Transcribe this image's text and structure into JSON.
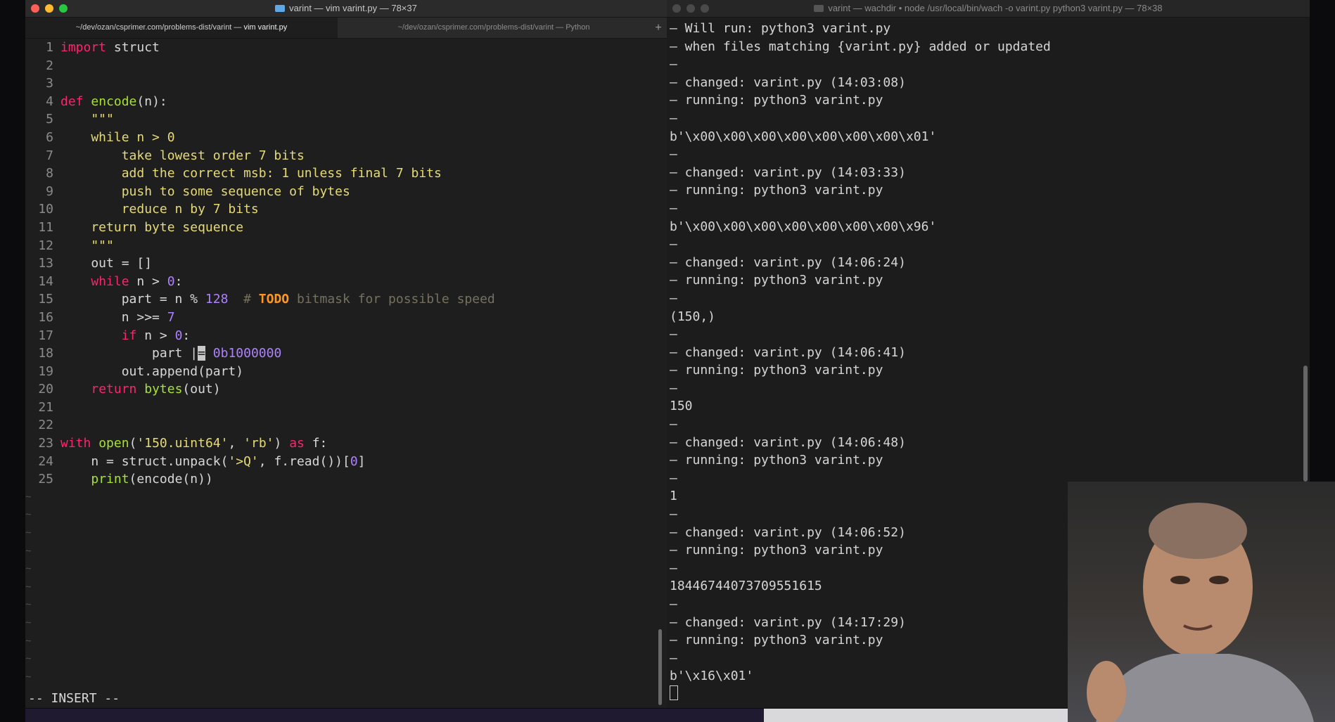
{
  "left_window": {
    "title": "varint — vim varint.py — 78×37",
    "tabs": [
      {
        "path": "~/dev/ozan/csprimer.com/problems-dist/varint — ",
        "cmd": "vim varint.py"
      },
      {
        "path": "~/dev/ozan/csprimer.com/problems-dist/varint — Python",
        "cmd": ""
      }
    ],
    "add_tab_label": "+",
    "code_lines": [
      {
        "n": "1",
        "segs": [
          [
            "kw",
            "import"
          ],
          [
            "p",
            " struct"
          ]
        ]
      },
      {
        "n": "2",
        "segs": []
      },
      {
        "n": "3",
        "segs": []
      },
      {
        "n": "4",
        "segs": [
          [
            "kw",
            "def"
          ],
          [
            "p",
            " "
          ],
          [
            "fn",
            "encode"
          ],
          [
            "p",
            "(n):"
          ]
        ]
      },
      {
        "n": "5",
        "segs": [
          [
            "str",
            "    \"\"\""
          ]
        ]
      },
      {
        "n": "6",
        "segs": [
          [
            "str",
            "    while n > 0"
          ]
        ]
      },
      {
        "n": "7",
        "segs": [
          [
            "str",
            "        take lowest order 7 bits"
          ]
        ]
      },
      {
        "n": "8",
        "segs": [
          [
            "str",
            "        add the correct msb: 1 unless final 7 bits"
          ]
        ]
      },
      {
        "n": "9",
        "segs": [
          [
            "str",
            "        push to some sequence of bytes"
          ]
        ]
      },
      {
        "n": "10",
        "segs": [
          [
            "str",
            "        reduce n by 7 bits"
          ]
        ]
      },
      {
        "n": "11",
        "segs": [
          [
            "str",
            "    return byte sequence"
          ]
        ]
      },
      {
        "n": "12",
        "segs": [
          [
            "str",
            "    \"\"\""
          ]
        ]
      },
      {
        "n": "13",
        "segs": [
          [
            "p",
            "    out = []"
          ]
        ]
      },
      {
        "n": "14",
        "segs": [
          [
            "p",
            "    "
          ],
          [
            "kw",
            "while"
          ],
          [
            "p",
            " n > "
          ],
          [
            "num",
            "0"
          ],
          [
            "p",
            ":"
          ]
        ]
      },
      {
        "n": "15",
        "segs": [
          [
            "p",
            "        part = n % "
          ],
          [
            "num",
            "128"
          ],
          [
            "p",
            "  "
          ],
          [
            "cmt",
            "# "
          ],
          [
            "todo",
            "TODO"
          ],
          [
            "cmt",
            " bitmask for possible speed"
          ]
        ]
      },
      {
        "n": "16",
        "segs": [
          [
            "p",
            "        n >>= "
          ],
          [
            "num",
            "7"
          ]
        ]
      },
      {
        "n": "17",
        "segs": [
          [
            "p",
            "        "
          ],
          [
            "kw",
            "if"
          ],
          [
            "p",
            " n > "
          ],
          [
            "num",
            "0"
          ],
          [
            "p",
            ":"
          ]
        ]
      },
      {
        "n": "18",
        "segs": [
          [
            "p",
            "            part |"
          ],
          [
            "cur",
            "="
          ],
          [
            "p",
            " "
          ],
          [
            "num",
            "0b1000000"
          ]
        ]
      },
      {
        "n": "19",
        "segs": [
          [
            "p",
            "        out.append(part)"
          ]
        ]
      },
      {
        "n": "20",
        "segs": [
          [
            "p",
            "    "
          ],
          [
            "kw",
            "return"
          ],
          [
            "p",
            " "
          ],
          [
            "fn",
            "bytes"
          ],
          [
            "p",
            "(out)"
          ]
        ]
      },
      {
        "n": "21",
        "segs": []
      },
      {
        "n": "22",
        "segs": []
      },
      {
        "n": "23",
        "segs": [
          [
            "kw",
            "with"
          ],
          [
            "p",
            " "
          ],
          [
            "fn",
            "open"
          ],
          [
            "p",
            "("
          ],
          [
            "str",
            "'150.uint64'"
          ],
          [
            "p",
            ", "
          ],
          [
            "str",
            "'rb'"
          ],
          [
            "p",
            ") "
          ],
          [
            "kw",
            "as"
          ],
          [
            "p",
            " f:"
          ]
        ]
      },
      {
        "n": "24",
        "segs": [
          [
            "p",
            "    n = struct.unpack("
          ],
          [
            "str",
            "'>Q'"
          ],
          [
            "p",
            ", f.read())["
          ],
          [
            "num",
            "0"
          ],
          [
            "p",
            "]"
          ]
        ]
      },
      {
        "n": "25",
        "segs": [
          [
            "p",
            "    "
          ],
          [
            "fn",
            "print"
          ],
          [
            "p",
            "(encode(n))"
          ]
        ]
      }
    ],
    "tilde_char": "~",
    "tilde_count": 11,
    "mode": "-- INSERT --"
  },
  "right_window": {
    "title": "varint — wachdir • node /usr/local/bin/wach -o varint.py python3 varint.py — 78×38",
    "lines": [
      "– Will run: python3 varint.py",
      "– when files matching {varint.py} added or updated",
      "–",
      "– changed: varint.py (14:03:08)",
      "– running: python3 varint.py",
      "–",
      "b'\\x00\\x00\\x00\\x00\\x00\\x00\\x00\\x01'",
      "–",
      "– changed: varint.py (14:03:33)",
      "– running: python3 varint.py",
      "–",
      "b'\\x00\\x00\\x00\\x00\\x00\\x00\\x00\\x96'",
      "–",
      "– changed: varint.py (14:06:24)",
      "– running: python3 varint.py",
      "–",
      "(150,)",
      "–",
      "– changed: varint.py (14:06:41)",
      "– running: python3 varint.py",
      "–",
      "150",
      "–",
      "– changed: varint.py (14:06:48)",
      "– running: python3 varint.py",
      "–",
      "1",
      "–",
      "– changed: varint.py (14:06:52)",
      "– running: python3 varint.py",
      "–",
      "18446744073709551615",
      "–",
      "– changed: varint.py (14:17:29)",
      "– running: python3 varint.py",
      "–",
      "b'\\x16\\x01'"
    ]
  }
}
